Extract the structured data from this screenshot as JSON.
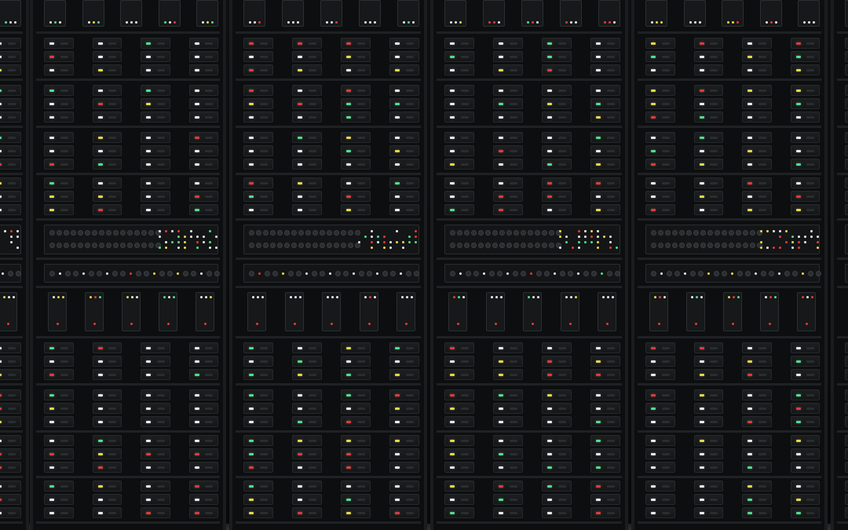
{
  "image": {
    "subject": "server-rack-wall",
    "rack_count": 5,
    "colors": {
      "background": "#0b0c0d",
      "rack_frame": "#1a1c1e",
      "drive_face": "#181a1c",
      "led_white": "#e9eef2",
      "led_green": "#4fe08a",
      "led_red": "#e23a3a",
      "led_yellow": "#e8d84a"
    }
  }
}
